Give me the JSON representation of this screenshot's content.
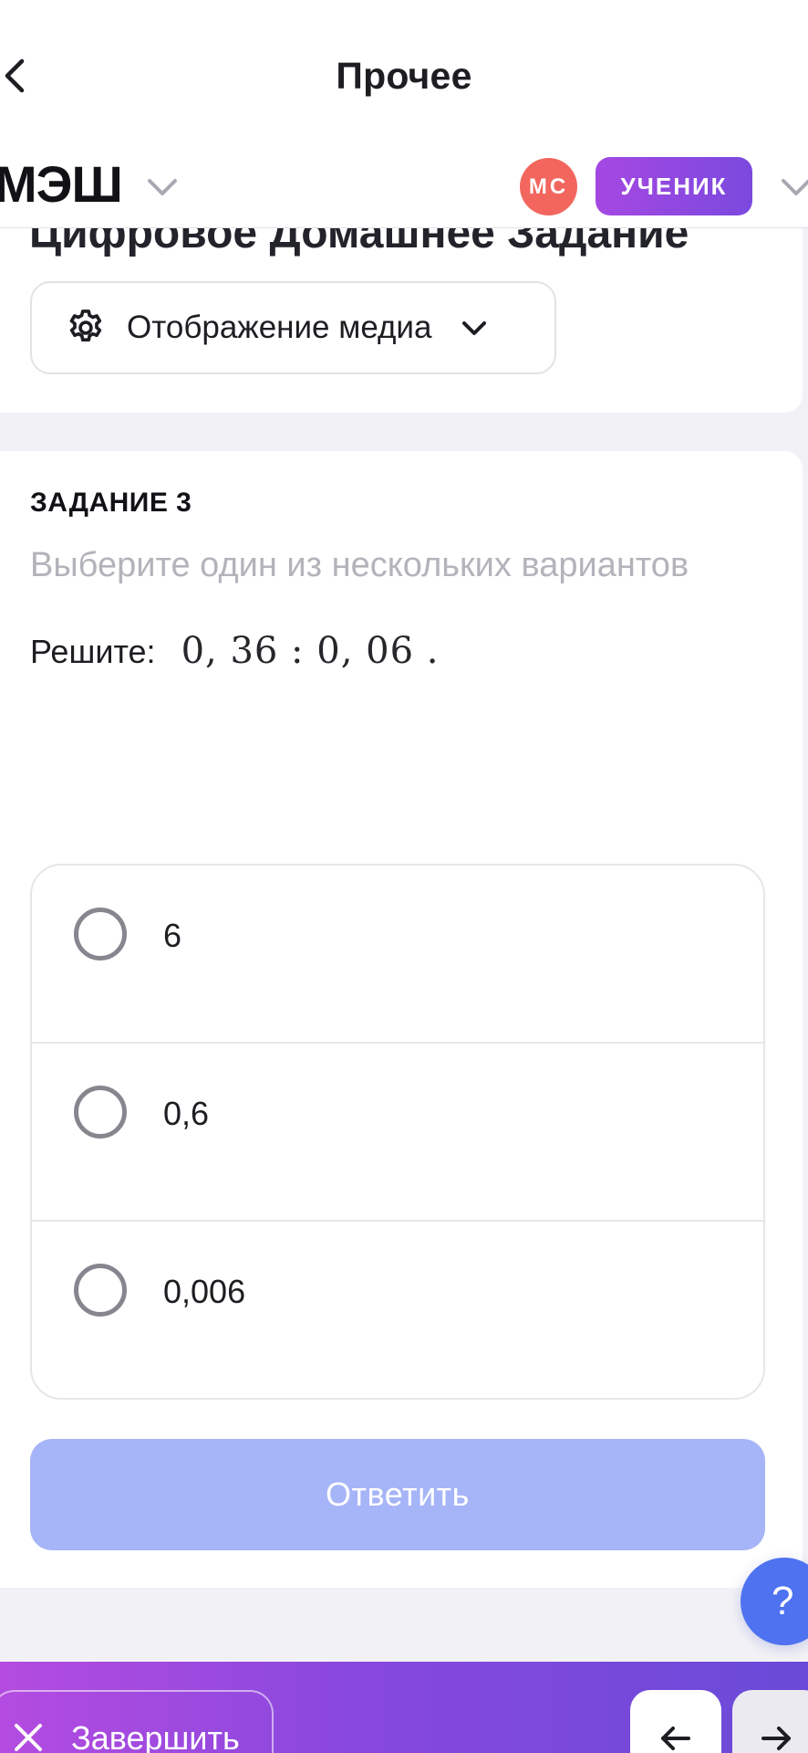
{
  "header": {
    "title": "Прочее",
    "brand": "МЭШ",
    "avatar_initials": "МС",
    "role_badge": "УЧЕНИК"
  },
  "homework_card": {
    "title": "Цифровое Домашнее Задание",
    "media_button_label": "Отображение медиа"
  },
  "task": {
    "label": "ЗАДАНИЕ 3",
    "hint": "Выберите один из нескольких вариантов",
    "problem_word": "Решите:",
    "expression": "0, 36 : 0, 06  .",
    "options": [
      {
        "text": "6",
        "selected": false
      },
      {
        "text": "0,6",
        "selected": false
      },
      {
        "text": "0,006",
        "selected": false
      }
    ],
    "submit_label": "Ответить",
    "submit_enabled": false
  },
  "help_button": "?",
  "footer": {
    "finish_label": "Завершить"
  },
  "colors": {
    "accent_gradient_start": "#b44be0",
    "accent_gradient_end": "#6a4ad8",
    "submit_disabled": "#a6b4f8",
    "help_button": "#4e72f0",
    "avatar": "#f2665e"
  }
}
